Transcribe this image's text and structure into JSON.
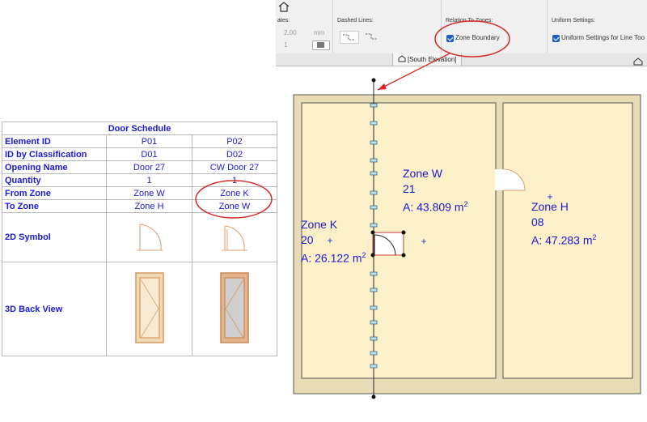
{
  "toolbar": {
    "partial_label": "ates:",
    "pen_value": "2.00",
    "unit": "mm",
    "small_value": "1",
    "dashed_lines_label": "Dashed Lines:",
    "relation_label": "Relation To Zones:",
    "zone_boundary_label": "Zone Boundary",
    "zone_boundary_checked": true,
    "uniform_label": "Uniform Settings:",
    "uniform_option_label": "Uniform Settings for Line Too",
    "uniform_checked": true
  },
  "view_tab": {
    "label": "[South Elevation]"
  },
  "schedule": {
    "title": "Door Schedule",
    "rows": [
      {
        "label": "Element ID",
        "p01": "P01",
        "p02": "P02"
      },
      {
        "label": "ID by Classification",
        "p01": "D01",
        "p02": "D02"
      },
      {
        "label": "Opening Name",
        "p01": "Door 27",
        "p02": "CW Door 27"
      },
      {
        "label": "Quantity",
        "p01": "1",
        "p02": "1"
      },
      {
        "label": "From Zone",
        "p01": "Zone W",
        "p02": "Zone K"
      },
      {
        "label": "To Zone",
        "p01": "Zone H",
        "p02": "Zone W"
      }
    ],
    "symbol_label": "2D Symbol",
    "back_view_label": "3D Back View"
  },
  "zones": [
    {
      "name": "Zone W",
      "number": "21",
      "area": "A: 43.809 m",
      "unit_exp": "2"
    },
    {
      "name": "Zone H",
      "number": "08",
      "area": "A: 47.283 m",
      "unit_exp": "2"
    },
    {
      "name": "Zone K",
      "number": "20",
      "area": "A: 26.122 m",
      "unit_exp": "2"
    }
  ],
  "colors": {
    "link_text": "#1a1ad6",
    "annotation_red": "#d62a2a",
    "checkbox_blue": "#1f5fbf",
    "zone_fill": "#fcf0c8",
    "wall_fill": "#e7dcb5"
  }
}
